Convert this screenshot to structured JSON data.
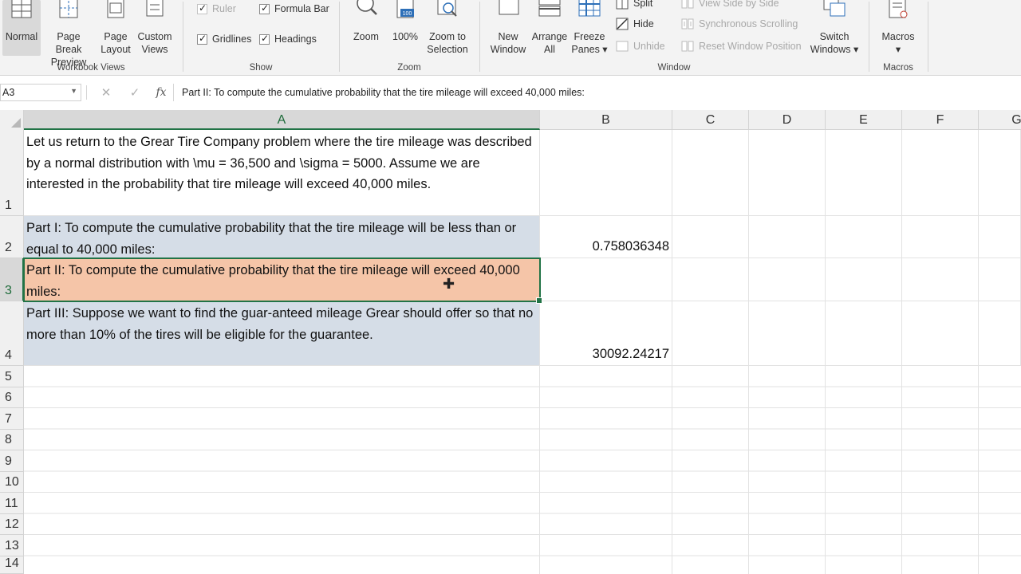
{
  "ribbon": {
    "workbook_views": {
      "label": "Workbook Views",
      "buttons": [
        "Normal",
        "Page Break\nPreview",
        "Page\nLayout",
        "Custom\nViews"
      ]
    },
    "show": {
      "label": "Show",
      "ruler": "Ruler",
      "formula_bar": "Formula Bar",
      "gridlines": "Gridlines",
      "headings": "Headings"
    },
    "zoom": {
      "label": "Zoom",
      "zoom": "Zoom",
      "hundred": "100%",
      "zoom_to_selection": "Zoom to\nSelection",
      "hundred_badge": "100"
    },
    "window": {
      "label": "Window",
      "new_window": "New\nWindow",
      "arrange_all": "Arrange\nAll",
      "freeze_panes": "Freeze\nPanes ▾",
      "split": "Split",
      "hide": "Hide",
      "unhide": "Unhide",
      "view_side_by_side": "View Side by Side",
      "synchronous_scrolling": "Synchronous Scrolling",
      "reset_window_position": "Reset Window Position",
      "switch_windows": "Switch\nWindows ▾"
    },
    "macros": {
      "label": "Macros",
      "button": "Macros\n▾"
    }
  },
  "formula_bar": {
    "name_box": "A3",
    "cancel_icon": "✕",
    "enter_icon": "✓",
    "fx": "fx",
    "content": "Part II: To compute the cumulative probability that the tire mileage will exceed 40,000 miles:"
  },
  "columns": [
    "A",
    "B",
    "C",
    "D",
    "E",
    "F",
    "G"
  ],
  "rows": [
    "1",
    "2",
    "3",
    "4",
    "5",
    "6",
    "7",
    "8",
    "9",
    "10",
    "11",
    "12",
    "13",
    "14"
  ],
  "cells": {
    "A1": "Let us return to the Grear Tire Company problem where the tire mileage was described by a normal distribution with \\mu = 36,500 and \\sigma = 5000. Assume we are interested in the probability that tire mileage will exceed 40,000 miles.",
    "A2": "Part I: To compute the cumulative probability that the tire mileage will be less than or equal to 40,000 miles:",
    "B2": "0.758036348",
    "A3": "Part II: To compute the cumulative probability that the tire mileage will exceed 40,000 miles:",
    "A4": "Part III:  Suppose we want to find the guar-anteed mileage Grear should offer so that no more than 10% of the tires will be eligible for the guarantee.",
    "B4": "30092.24217"
  },
  "colors": {
    "accent": "#217346",
    "part_fill": "#d5dde7",
    "selected_fill": "#f5c5a8"
  }
}
